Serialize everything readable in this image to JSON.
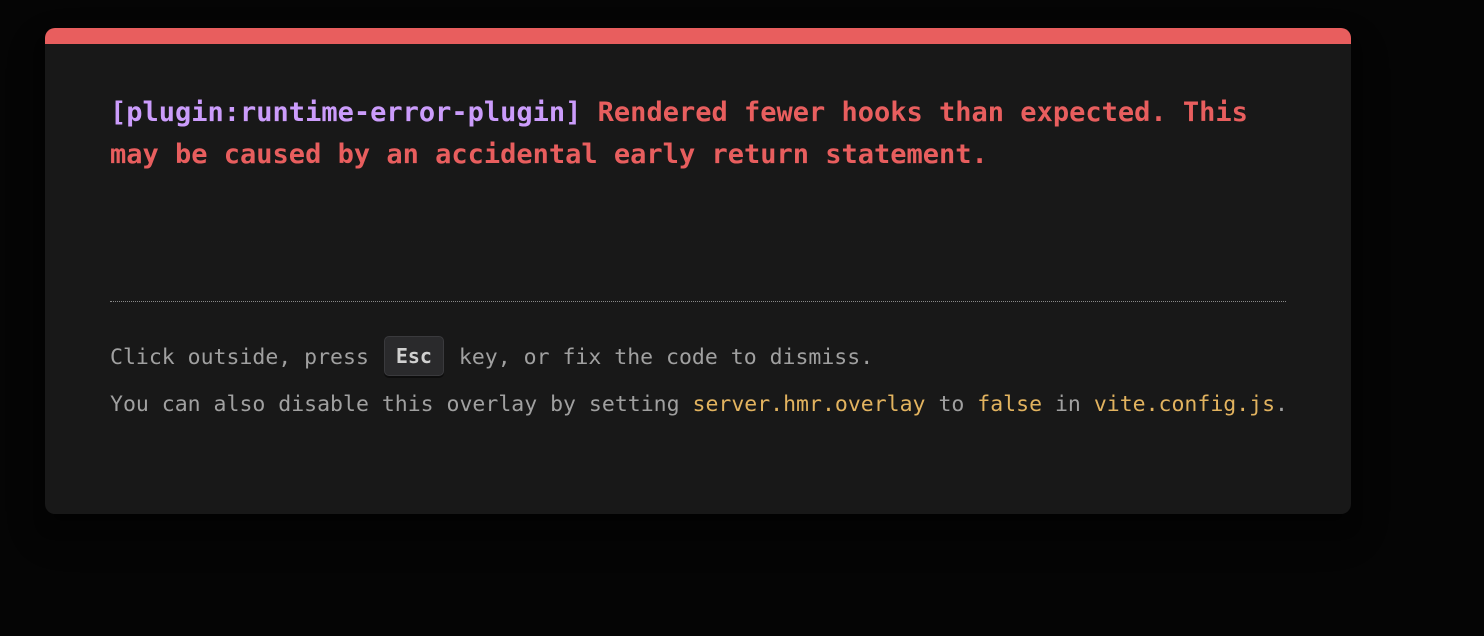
{
  "error": {
    "plugin": "[plugin:runtime-error-plugin]",
    "message": "Rendered fewer hooks than expected. This may be caused by an accidental early return statement."
  },
  "tip": {
    "line1_prefix": "Click outside, press",
    "esc_key": "Esc",
    "line1_suffix": "key, or fix the code to dismiss.",
    "line2_prefix": "You can also disable this overlay by setting",
    "setting_name": "server.hmr.overlay",
    "line2_to": "to",
    "setting_value": "false",
    "line2_in": "in",
    "config_file": "vite.config.js",
    "period": "."
  },
  "colors": {
    "accent_red": "#e85e5e",
    "plugin_purple": "#cb9cfb",
    "code_yellow": "#e2b35f",
    "window_bg": "#181818",
    "backdrop_bg": "#050505"
  }
}
